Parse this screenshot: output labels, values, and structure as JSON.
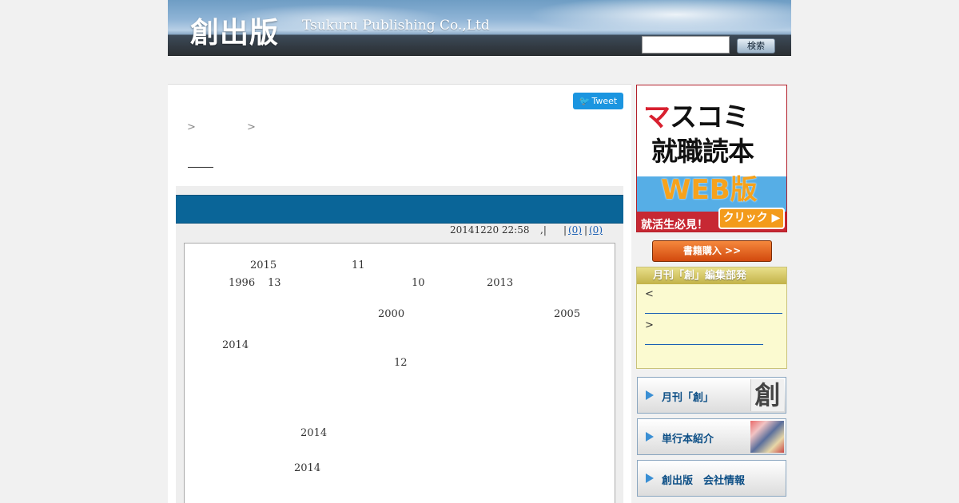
{
  "header": {
    "logo_jp": "創出版",
    "logo_en": "Tsukuru Publishing Co.,Ltd",
    "search_placeholder": "",
    "search_button": "検索"
  },
  "main": {
    "tweet_label": "Tweet",
    "breadcrumb": {
      "sep": ">"
    },
    "meta": {
      "date": "20141220 22:58",
      "sep1": ",|",
      "sep2": "|",
      "comments": "(0)",
      "sep3": "|",
      "trackbacks": "(0)"
    },
    "numbers": [
      "2015",
      "11",
      "1996",
      "13",
      "10",
      "2013",
      "2000",
      "2005",
      "2014",
      "12",
      "2014",
      "2014"
    ]
  },
  "sidebar": {
    "banner": {
      "line1_ma": "マ",
      "line1_rest": "スコミ",
      "line2": "就職読本",
      "line3": "WEB版",
      "must": "就活生必見！",
      "click": "クリック ▶"
    },
    "buy_button": "書籍購入 >>",
    "blog": {
      "title": "月刊「創」編集部発",
      "prev": "<",
      "next": ">"
    },
    "nav": [
      {
        "label": "月刊「創」",
        "thumb": "創"
      },
      {
        "label": "単行本紹介"
      },
      {
        "label": "創出版　会社情報"
      }
    ]
  }
}
